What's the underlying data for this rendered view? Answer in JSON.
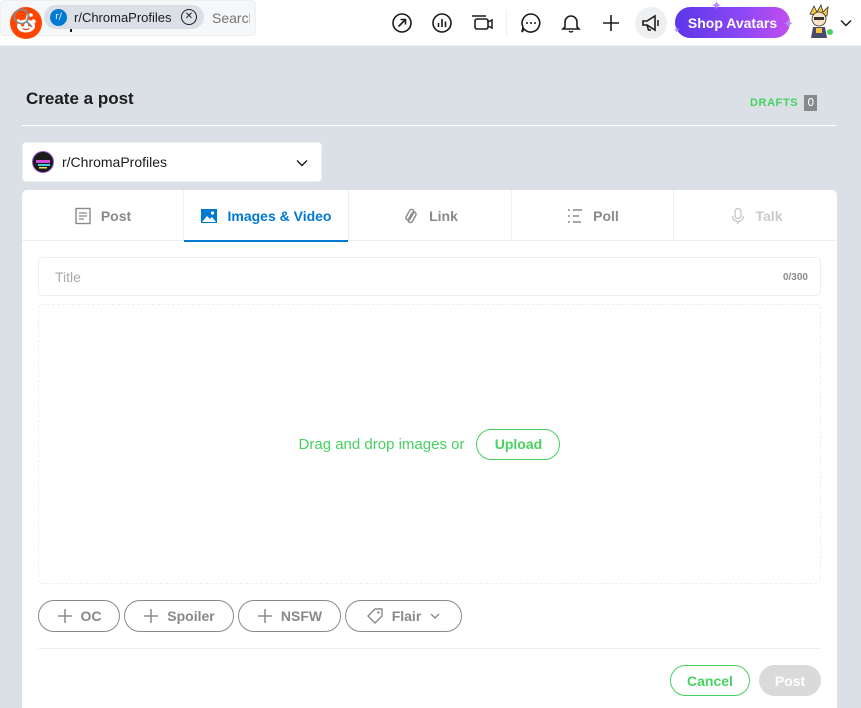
{
  "topbar": {
    "search": {
      "community_chip_badge": "r/",
      "community_chip_label": "r/ChromaProfiles",
      "placeholder": "Search Reddit"
    },
    "shop_label": "Shop Avatars",
    "icons": [
      "reddit-logo-icon",
      "create-post-plus-icon",
      "search-icon",
      "popular-icon",
      "explore-icon",
      "live-video-icon",
      "chat-icon",
      "notifications-bell-icon",
      "create-plus-icon",
      "advertise-megaphone-icon",
      "user-avatar",
      "chevron-down-icon"
    ]
  },
  "header": {
    "title": "Create a post",
    "drafts_label": "DRAFTS",
    "drafts_count": "0"
  },
  "community_selector": {
    "selected": "r/ChromaProfiles"
  },
  "tabs": [
    {
      "label": "Post",
      "icon": "post-icon",
      "state": "default"
    },
    {
      "label": "Images & Video",
      "icon": "image-icon",
      "state": "active"
    },
    {
      "label": "Link",
      "icon": "link-icon",
      "state": "default"
    },
    {
      "label": "Poll",
      "icon": "poll-icon",
      "state": "default"
    },
    {
      "label": "Talk",
      "icon": "microphone-icon",
      "state": "disabled"
    }
  ],
  "form": {
    "title_placeholder": "Title",
    "title_value": "",
    "title_counter": "0/300",
    "dropzone_text": "Drag and drop images or",
    "upload_label": "Upload"
  },
  "tags": [
    {
      "label": "OC",
      "icon": "plus-icon"
    },
    {
      "label": "Spoiler",
      "icon": "plus-icon"
    },
    {
      "label": "NSFW",
      "icon": "plus-icon"
    },
    {
      "label": "Flair",
      "icon": "tag-icon"
    }
  ],
  "actions": {
    "cancel_label": "Cancel",
    "post_label": "Post"
  },
  "colors": {
    "accent_blue": "#0079d3",
    "green": "#46d160",
    "brand_orange": "#ff4500",
    "background": "#dae0e6"
  }
}
